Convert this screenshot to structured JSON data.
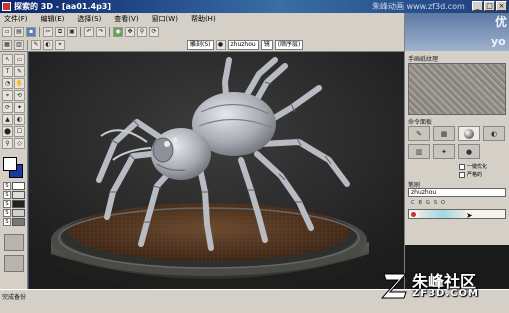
{
  "window": {
    "title": "探索的 3D - [aa01.4p3]",
    "watermark": "朱峰动画 www.zf3d.com",
    "controls": [
      "_",
      "□",
      "×"
    ]
  },
  "menu": [
    "文件(F)",
    "编辑(E)",
    "选择(S)",
    "查看(V)",
    "窗口(W)",
    "帮助(H)"
  ],
  "toolbar": {
    "row1_icons": [
      "new-icon",
      "open-icon",
      "save-icon",
      "cut-icon",
      "copy-icon",
      "paste-icon",
      "undo-icon",
      "redo-icon",
      "camera-icon",
      "move-icon",
      "zoom-icon",
      "rotate-icon"
    ],
    "row2_mode": "雕刻(S)",
    "row2_layer": "zhuzhou",
    "row2_paint": "镜",
    "row2_extra": "(顺序层)"
  },
  "left_tools": [
    "↖",
    "▭",
    "T",
    "✎",
    "◔",
    "✋",
    "⌖",
    "⟲",
    "⟳",
    "✦",
    "▲",
    "◐",
    "⬤",
    "☐",
    "⚲",
    "◇"
  ],
  "color_rows": [
    {
      "label": "S",
      "color": "#ffffff"
    },
    {
      "label": "S",
      "color": "#dddddd"
    },
    {
      "label": "S",
      "color": "#222222"
    },
    {
      "label": "S",
      "color": "#cfcfcf"
    },
    {
      "label": "S",
      "color": "#777777"
    }
  ],
  "right_panel": {
    "ad_text": [
      "yo",
      "优"
    ],
    "texture_caption": "手画纸纹理",
    "command_caption": "命令面板",
    "opt1": "一键优化",
    "opt2": "严格的",
    "brush_label": "笔刷",
    "brush_value": "zhuzhou",
    "channels": [
      "C",
      "B",
      "G",
      "S",
      "O"
    ],
    "slider_level": 0.55
  },
  "status": "完成备份",
  "brand": {
    "cn": "朱峰社区",
    "en": "ZF3D.COM"
  },
  "colors": {
    "accent": "#0a246a",
    "chrome": "#d4d0c8",
    "base_wood": "#5a3a22",
    "spider": "#b8bcc2"
  }
}
